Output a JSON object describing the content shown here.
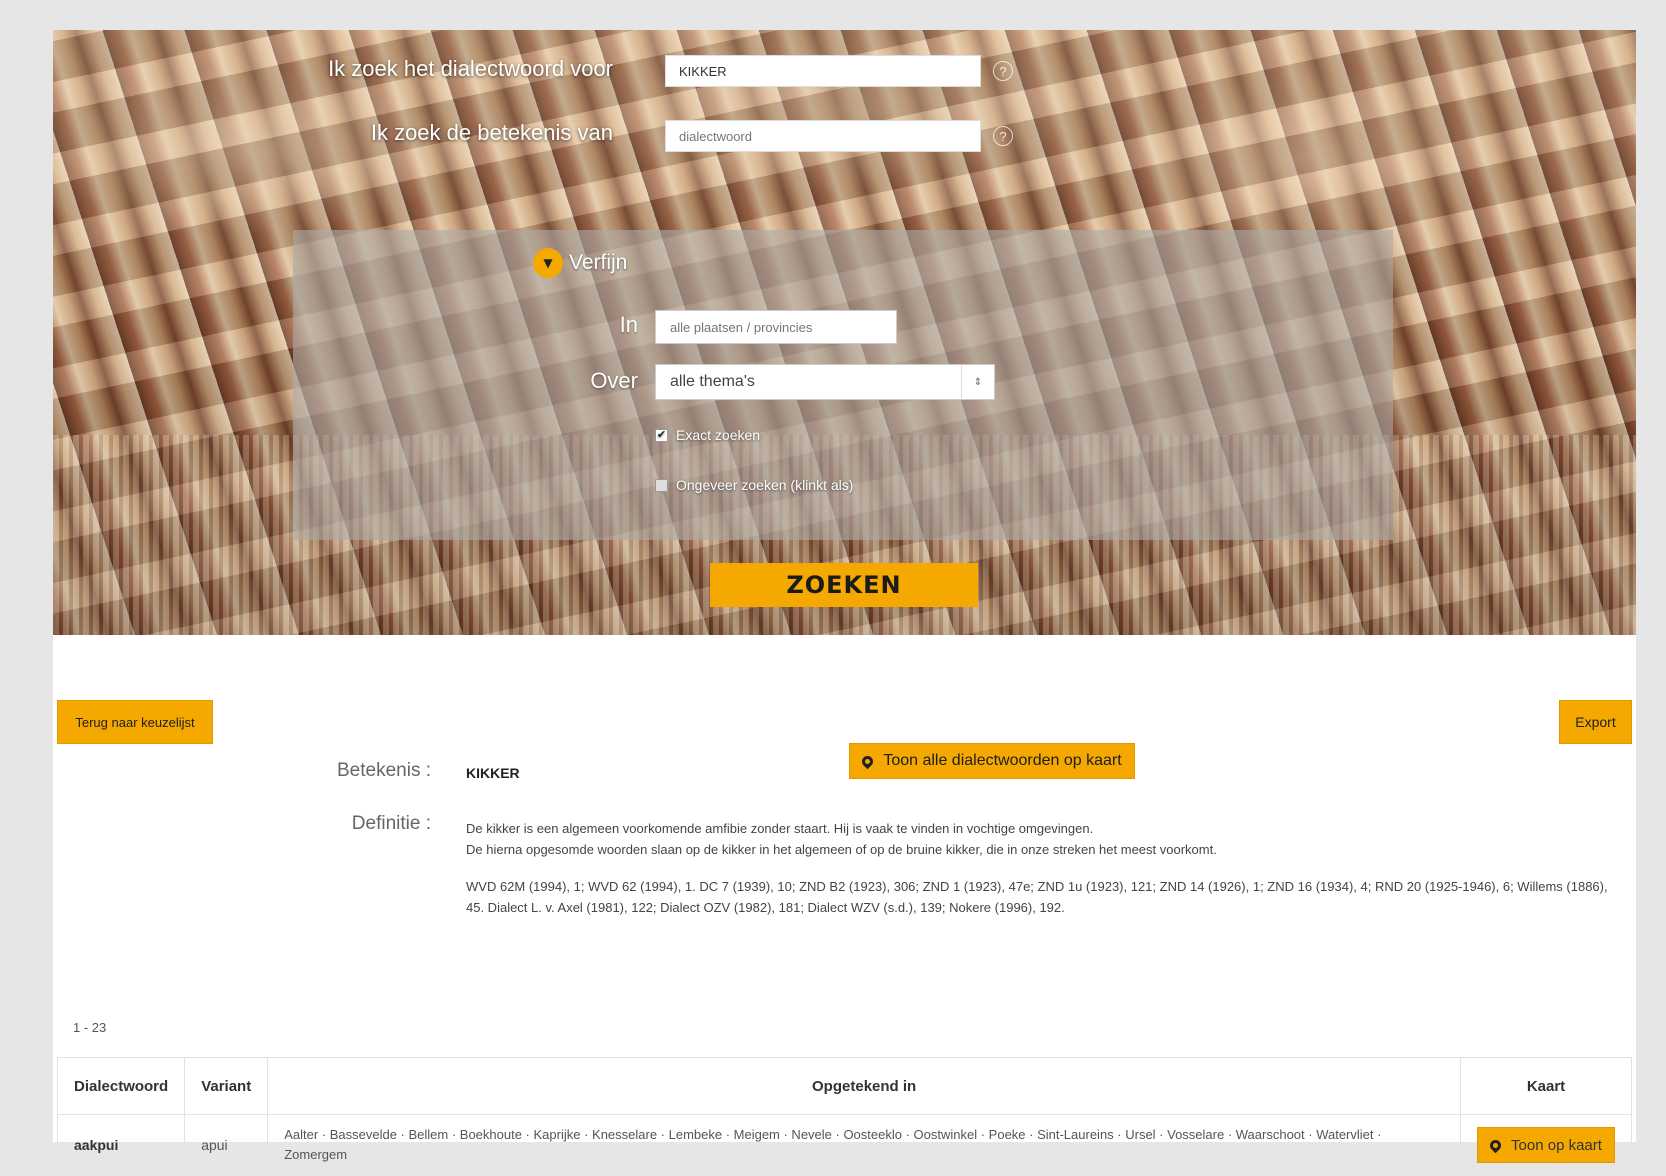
{
  "search": {
    "dialect_label": "Ik zoek het dialectwoord voor",
    "dialect_value": "KIKKER",
    "meaning_label": "Ik zoek de betekenis van",
    "meaning_placeholder": "dialectwoord",
    "help_glyph": "?"
  },
  "refine": {
    "toggle_label": "Verfijn",
    "toggle_icon": "chevron-down-icon",
    "in_label": "In",
    "in_placeholder": "alle plaatsen / provincies",
    "over_label": "Over",
    "over_selected": "alle thema's",
    "exact_label": "Exact zoeken",
    "exact_checked": true,
    "fuzzy_label": "Ongeveer zoeken (klinkt als)",
    "fuzzy_checked": false
  },
  "search_button": "ZOEKEN",
  "results": {
    "back_button": "Terug naar keuzelijst",
    "export_button": "Export",
    "map_all_button": "Toon alle dialectwoorden op kaart",
    "meaning_label": "Betekenis :",
    "meaning_value": "KIKKER",
    "definition_label": "Definitie :",
    "definition_line1": "De kikker is een algemeen voorkomende amfibie zonder staart. Hij is vaak te vinden in vochtige omgevingen.",
    "definition_line2": "De hierna opgesomde woorden slaan op de kikker in het algemeen of op de bruine kikker, die in onze streken het meest voorkomt.",
    "references": "WVD 62M (1994), 1; WVD 62 (1994), 1. DC 7 (1939), 10; ZND B2 (1923), 306; ZND 1 (1923), 47e; ZND 1u (1923), 121; ZND 14 (1926), 1; ZND 16 (1934), 4; RND 20 (1925-1946), 6; Willems (1886), 45. Dialect L. v. Axel (1981), 122; Dialect OZV (1982), 181; Dialect WZV (s.d.), 139; Nokere (1996), 192.",
    "count": "1 - 23",
    "columns": [
      "Dialectwoord",
      "Variant",
      "Opgetekend in",
      "Kaart"
    ],
    "rows": [
      {
        "word": "aakpui",
        "variant": "apui",
        "places": "Aalter · Bassevelde · Bellem · Boekhoute · Kaprijke · Knesselare · Lembeke · Meigem · Nevele · Oosteeklo · Oostwinkel · Poeke · Sint-Laureins · Ursel · Vosselare · Waarschoot · Watervliet · Zomergem",
        "map_button": "Toon op kaart"
      }
    ]
  },
  "colors": {
    "accent": "#f5a800",
    "page_bg": "#e6e6e6"
  }
}
